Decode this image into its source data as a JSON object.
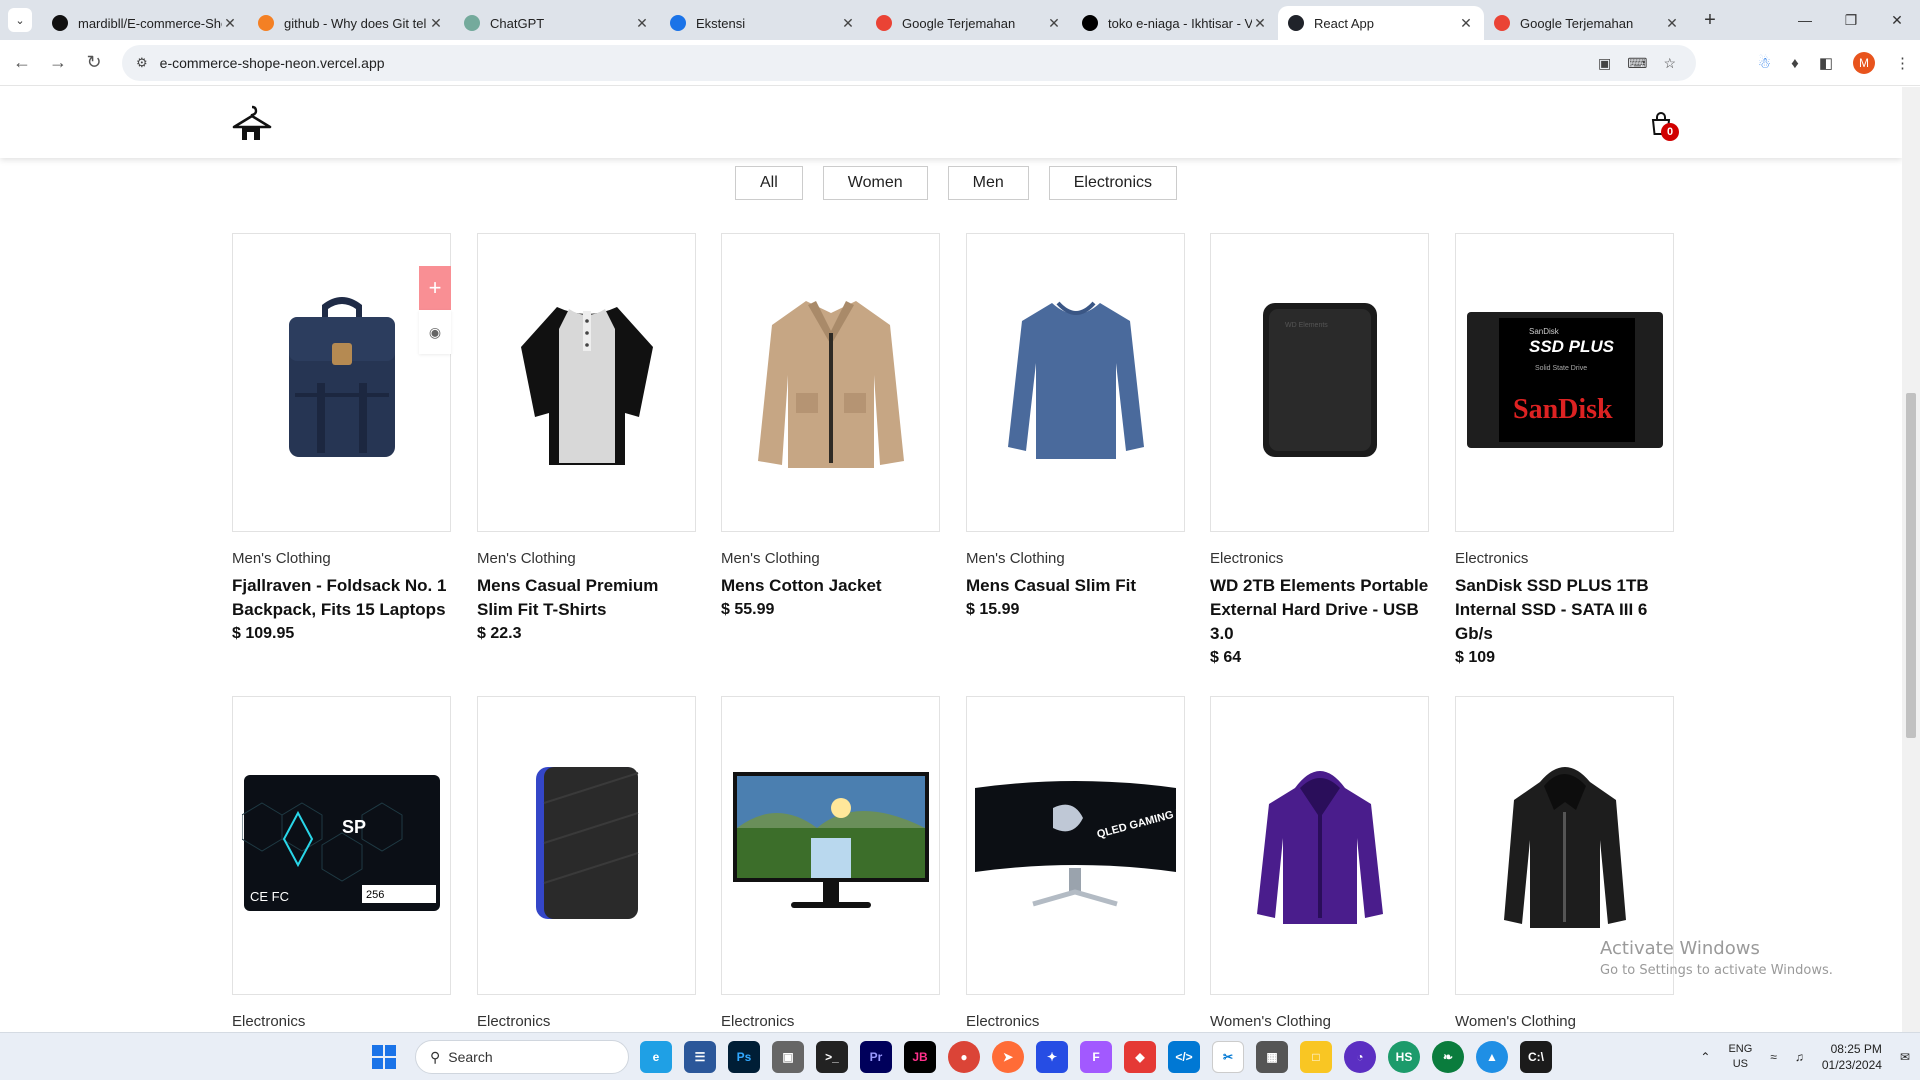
{
  "browser": {
    "tabs": [
      {
        "title": "mardibll/E-commerce-Sho",
        "favicon": "github-icon",
        "color": "#111111",
        "active": false
      },
      {
        "title": "github - Why does Git tel",
        "favicon": "stackoverflow-icon",
        "color": "#f48024",
        "active": false
      },
      {
        "title": "ChatGPT",
        "favicon": "chatgpt-icon",
        "color": "#74aa9c",
        "active": false
      },
      {
        "title": "Ekstensi",
        "favicon": "puzzle-icon",
        "color": "#1a73e8",
        "active": false
      },
      {
        "title": "Google Terjemahan",
        "favicon": "translate-icon",
        "color": "#ea4335",
        "active": false
      },
      {
        "title": "toko e-niaga - Ikhtisar - V",
        "favicon": "vercel-icon",
        "color": "#000000",
        "active": false
      },
      {
        "title": "React App",
        "favicon": "react-icon",
        "color": "#20232a",
        "active": true
      },
      {
        "title": "Google Terjemahan",
        "favicon": "translate-icon",
        "color": "#ea4335",
        "active": false
      }
    ],
    "url": "e-commerce-shope-neon.vercel.app",
    "profile_initial": "M"
  },
  "header": {
    "cart_count": "0"
  },
  "filters": [
    "All",
    "Women",
    "Men",
    "Electronics"
  ],
  "products": [
    {
      "category": "Men's Clothing",
      "title": "Fjallraven - Foldsack No. 1 Backpack, Fits 15 Laptops",
      "price": "$ 109.95",
      "image": "backpack"
    },
    {
      "category": "Men's Clothing",
      "title": "Mens Casual Premium Slim Fit T-Shirts",
      "price": "$ 22.3",
      "image": "raglan-tshirt"
    },
    {
      "category": "Men's Clothing",
      "title": "Mens Cotton Jacket",
      "price": "$ 55.99",
      "image": "jacket"
    },
    {
      "category": "Men's Clothing",
      "title": "Mens Casual Slim Fit",
      "price": "$ 15.99",
      "image": "longsleeve"
    },
    {
      "category": "Electronics",
      "title": "WD 2TB Elements Portable External Hard Drive - USB 3.0",
      "price": "$ 64",
      "image": "hdd-black"
    },
    {
      "category": "Electronics",
      "title": "SanDisk SSD PLUS 1TB Internal SSD - SATA III 6 Gb/s",
      "price": "$ 109",
      "image": "sandisk-ssd"
    },
    {
      "category": "Electronics",
      "title": "",
      "price": "",
      "image": "sp-ssd"
    },
    {
      "category": "Electronics",
      "title": "",
      "price": "",
      "image": "wd-gaming-drive"
    },
    {
      "category": "Electronics",
      "title": "",
      "price": "",
      "image": "monitor"
    },
    {
      "category": "Electronics",
      "title": "",
      "price": "",
      "image": "curved-monitor"
    },
    {
      "category": "Women's Clothing",
      "title": "",
      "price": "",
      "image": "purple-jacket"
    },
    {
      "category": "Women's Clothing",
      "title": "",
      "price": "",
      "image": "leather-jacket"
    }
  ],
  "image_text": {
    "sandisk_small": "SanDisk",
    "sandisk_model": "SSD PLUS",
    "sandisk_sub": "Solid State Drive",
    "sandisk_brand": "SanDisk",
    "sp_logo": "SP",
    "sp_cap": "256",
    "curved_text": "QLED GAMING MONITOR"
  },
  "watermark": {
    "line1": "Activate Windows",
    "line2": "Go to Settings to activate Windows."
  },
  "taskbar": {
    "search_placeholder": "Search",
    "lang_line1": "ENG",
    "lang_line2": "US",
    "time": "08:25 PM",
    "date": "01/23/2024"
  }
}
